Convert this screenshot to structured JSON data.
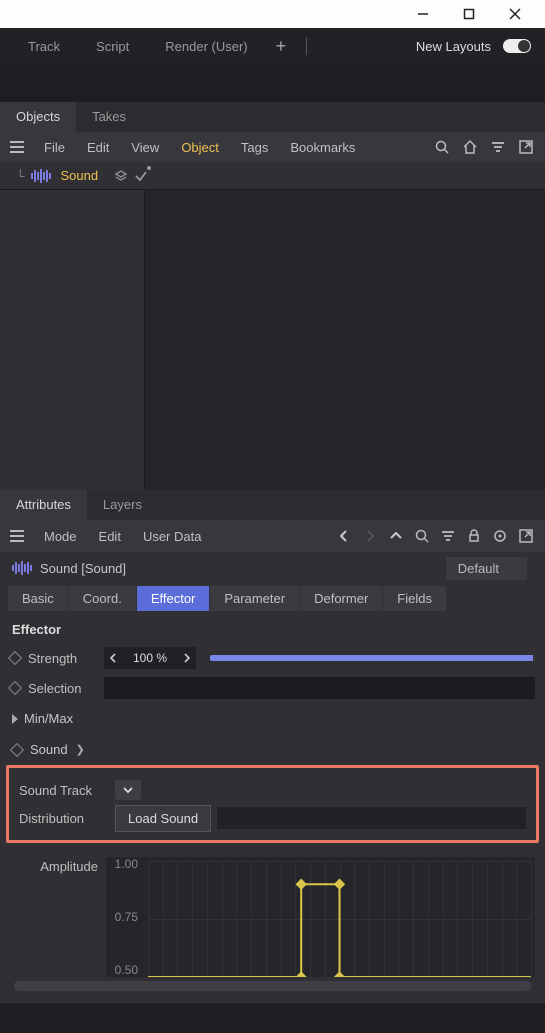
{
  "layout_bar": {
    "tabs": [
      "Track",
      "Script",
      "Render (User)"
    ],
    "new_layouts": "New Layouts"
  },
  "objects_panel": {
    "tabs": {
      "objects": "Objects",
      "takes": "Takes"
    },
    "menu": {
      "file": "File",
      "edit": "Edit",
      "view": "View",
      "object": "Object",
      "tags": "Tags",
      "bookmarks": "Bookmarks"
    },
    "tree_item": "Sound"
  },
  "attributes_panel": {
    "tabs": {
      "attributes": "Attributes",
      "layers": "Layers"
    },
    "menu": {
      "mode": "Mode",
      "edit": "Edit",
      "user_data": "User Data"
    },
    "title": "Sound [Sound]",
    "default_label": "Default",
    "sub_tabs": {
      "basic": "Basic",
      "coord": "Coord.",
      "effector": "Effector",
      "parameter": "Parameter",
      "deformer": "Deformer",
      "fields": "Fields"
    }
  },
  "effector": {
    "header": "Effector",
    "strength_label": "Strength",
    "strength_value": "100 %",
    "selection_label": "Selection",
    "minmax_label": "Min/Max"
  },
  "sound_section": {
    "label": "Sound",
    "sound_track_label": "Sound Track",
    "distribution_label": "Distribution",
    "load_sound_label": "Load Sound"
  },
  "amplitude": {
    "label": "Amplitude",
    "ticks": [
      "1.00",
      "0.75",
      "0.50"
    ]
  },
  "chart_data": {
    "type": "line",
    "title": "Amplitude",
    "ylabel": "",
    "ylim": [
      0.5,
      1.0
    ],
    "x": [
      0,
      0.4,
      0.4,
      0.5,
      0.5,
      1.0
    ],
    "values": [
      0.5,
      0.5,
      0.9,
      0.9,
      0.5,
      0.5
    ],
    "control_points_x": [
      0.4,
      0.5
    ],
    "control_points_y": [
      0.9,
      0.9
    ]
  }
}
